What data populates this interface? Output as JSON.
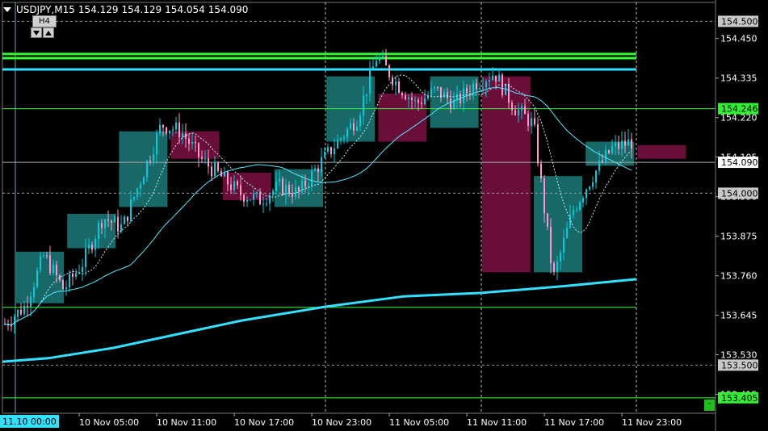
{
  "header": {
    "symbol_tf": "USDJPY,M15",
    "open": "154.129",
    "high": "154.129",
    "low": "154.054",
    "close": "154.090"
  },
  "htf_panel": {
    "label": "H4"
  },
  "colors": {
    "background": "#000000",
    "bull_box": "#1a6e6e",
    "bear_box": "#6e0f3c",
    "candle_bull": "#00ccdd",
    "candle_bear": "#ff99cc",
    "ma_line": "#33e0ff",
    "level_line": "#33ff33",
    "grid": "#c0c0c0"
  },
  "chart_data": {
    "type": "candlestick",
    "symbol": "USDJPY",
    "timeframe": "M15",
    "ylim": [
      153.36,
      154.555
    ],
    "y_ticks": [
      "154.450",
      "154.335",
      "154.220",
      "154.105",
      "153.990",
      "153.875",
      "153.760",
      "153.645",
      "153.530",
      "153.415"
    ],
    "x_ticks": [
      "10 Nov 05:00",
      "10 Nov 11:00",
      "10 Nov 17:00",
      "10 Nov 23:00",
      "11 Nov 05:00",
      "11 Nov 11:00",
      "11 Nov 17:00",
      "11 Nov 23:00"
    ],
    "x_start_label": "11.10 00:00",
    "price_labels": [
      {
        "value": "154.500",
        "price": 154.5,
        "style": "gray"
      },
      {
        "value": "154.246",
        "price": 154.246,
        "style": "green"
      },
      {
        "value": "154.090",
        "price": 154.09,
        "style": "white"
      },
      {
        "value": "154.000",
        "price": 154.0,
        "style": "gray"
      },
      {
        "value": "153.500",
        "price": 153.5,
        "style": "gray"
      },
      {
        "value": "153.405",
        "price": 153.405,
        "style": "green"
      }
    ],
    "horizontal_levels": [
      {
        "price": 154.5,
        "color": "#999999",
        "style": "dashed"
      },
      {
        "price": 154.0,
        "color": "#999999",
        "style": "dashed"
      },
      {
        "price": 153.5,
        "color": "#999999",
        "style": "dashed"
      },
      {
        "price": 154.09,
        "color": "#aaaaaa",
        "style": "solid"
      },
      {
        "price": 154.246,
        "color": "#33ee33",
        "style": "solid"
      },
      {
        "price": 154.405,
        "color": "#33ff33",
        "style": "bold"
      },
      {
        "price": 154.393,
        "color": "#33ff33",
        "style": "bold"
      },
      {
        "price": 154.36,
        "color": "#33e0ff",
        "style": "bold"
      },
      {
        "price": 153.668,
        "color": "#33ff33",
        "style": "solid"
      },
      {
        "price": 153.405,
        "color": "#33ff33",
        "style": "solid"
      }
    ],
    "htf_boxes": [
      {
        "open": 153.83,
        "close": 153.68,
        "dir": "bull"
      },
      {
        "open": 153.94,
        "close": 153.84,
        "dir": "bull"
      },
      {
        "open": 154.18,
        "close": 153.96,
        "dir": "bull"
      },
      {
        "open": 154.18,
        "close": 154.1,
        "dir": "bear"
      },
      {
        "open": 154.06,
        "close": 153.98,
        "dir": "bear"
      },
      {
        "open": 154.07,
        "close": 153.96,
        "dir": "bull"
      },
      {
        "open": 154.34,
        "close": 154.15,
        "dir": "bull"
      },
      {
        "open": 154.29,
        "close": 154.15,
        "dir": "bear"
      },
      {
        "open": 154.34,
        "close": 154.19,
        "dir": "bull"
      },
      {
        "open": 154.34,
        "close": 153.77,
        "dir": "bear"
      },
      {
        "open": 154.05,
        "close": 153.77,
        "dir": "bull"
      },
      {
        "open": 154.15,
        "close": 154.08,
        "dir": "bull"
      },
      {
        "open": 154.14,
        "close": 154.1,
        "dir": "bear"
      }
    ],
    "series": [
      {
        "name": "",
        "price_path": [
          153.62,
          153.67,
          153.82,
          153.72,
          153.8,
          153.93,
          153.9,
          154.05,
          154.2,
          154.18,
          154.1,
          154.05,
          154.0,
          153.98,
          154.02,
          154.0,
          154.08,
          154.15,
          154.22,
          154.4,
          154.32,
          154.26,
          154.3,
          154.26,
          154.32,
          154.35,
          154.25,
          154.2,
          153.75,
          153.95,
          154.05,
          154.13,
          154.15
        ]
      }
    ]
  }
}
